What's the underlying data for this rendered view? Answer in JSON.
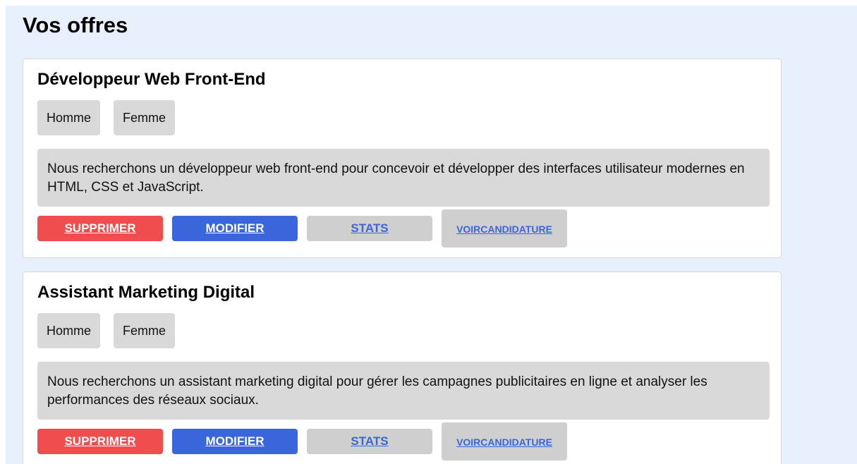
{
  "page": {
    "title": "Vos offres"
  },
  "offers": [
    {
      "title": "Développeur Web Front-End",
      "genders": [
        "Homme",
        "Femme"
      ],
      "description": "Nous recherchons un développeur web front-end pour concevoir et développer des interfaces utilisateur modernes en HTML, CSS et JavaScript.",
      "actions": {
        "delete": "SUPPRIMER",
        "edit": "MODIFIER",
        "stats": "STATS",
        "view_applications_line1": "VOIR",
        "view_applications_line2": "CANDIDATURE"
      }
    },
    {
      "title": "Assistant Marketing Digital",
      "genders": [
        "Homme",
        "Femme"
      ],
      "description": "Nous recherchons un assistant marketing digital pour gérer les campagnes publicitaires en ligne et analyser les performances des réseaux sociaux.",
      "actions": {
        "delete": "SUPPRIMER",
        "edit": "MODIFIER",
        "stats": "STATS",
        "view_applications_line1": "VOIR",
        "view_applications_line2": "CANDIDATURE"
      }
    }
  ],
  "colors": {
    "page_background": "#e8f0fc",
    "delete_button": "#f04e4e",
    "edit_button": "#3a66db",
    "neutral_button": "#cfcfcf",
    "link_text": "#3a66db"
  }
}
